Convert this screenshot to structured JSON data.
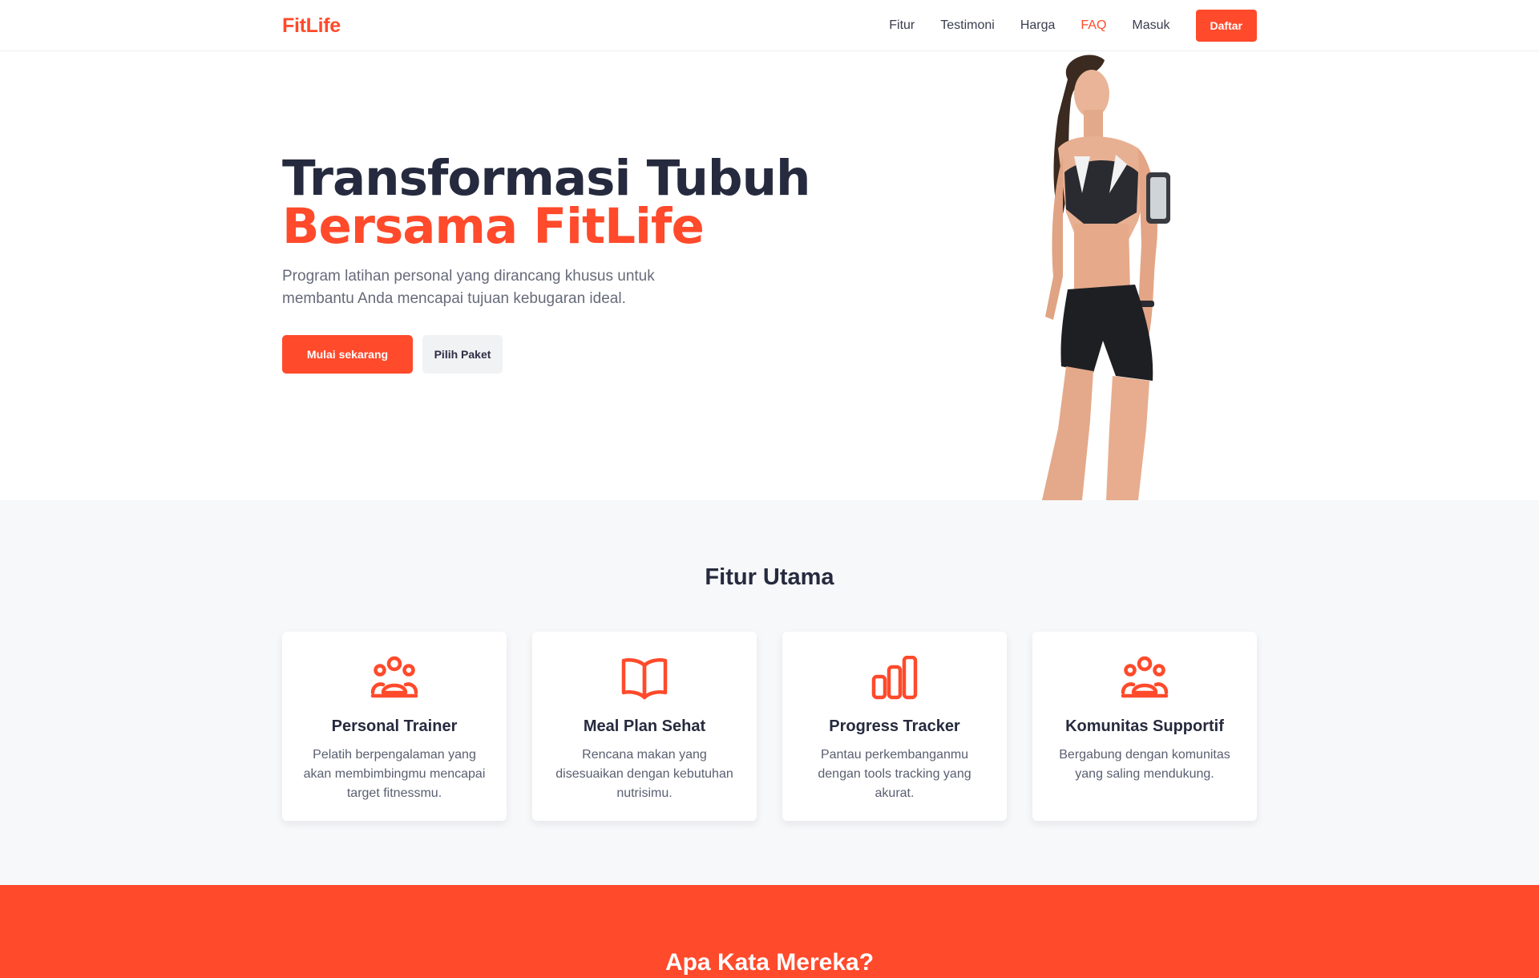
{
  "brand": {
    "name": "FitLife",
    "accent": "#ff4a2b",
    "dark": "#262a3e"
  },
  "nav": {
    "links": [
      {
        "label": "Fitur",
        "active": false
      },
      {
        "label": "Testimoni",
        "active": false
      },
      {
        "label": "Harga",
        "active": false
      },
      {
        "label": "FAQ",
        "active": true
      },
      {
        "label": "Masuk",
        "active": false
      }
    ],
    "cta": "Daftar"
  },
  "hero": {
    "title_line1": "Transformasi Tubuh",
    "title_line2": "Bersama FitLife",
    "subtitle": "Program latihan personal yang dirancang khusus untuk membantu Anda mencapai tujuan kebugaran ideal.",
    "primary_cta": "Mulai sekarang",
    "secondary_cta": "Pilih Paket"
  },
  "features": {
    "title": "Fitur Utama",
    "items": [
      {
        "icon": "users-icon",
        "title": "Personal Trainer",
        "desc": "Pelatih berpengalaman yang akan membimbingmu mencapai target fitnessmu."
      },
      {
        "icon": "book-open-icon",
        "title": "Meal Plan Sehat",
        "desc": "Rencana makan yang disesuaikan dengan kebutuhan nutrisimu."
      },
      {
        "icon": "bar-chart-icon",
        "title": "Progress Tracker",
        "desc": "Pantau perkembanganmu dengan tools tracking yang akurat."
      },
      {
        "icon": "users-icon",
        "title": "Komunitas Supportif",
        "desc": "Bergabung dengan komunitas yang saling mendukung."
      }
    ]
  },
  "testimonials": {
    "title": "Apa Kata Mereka?"
  }
}
